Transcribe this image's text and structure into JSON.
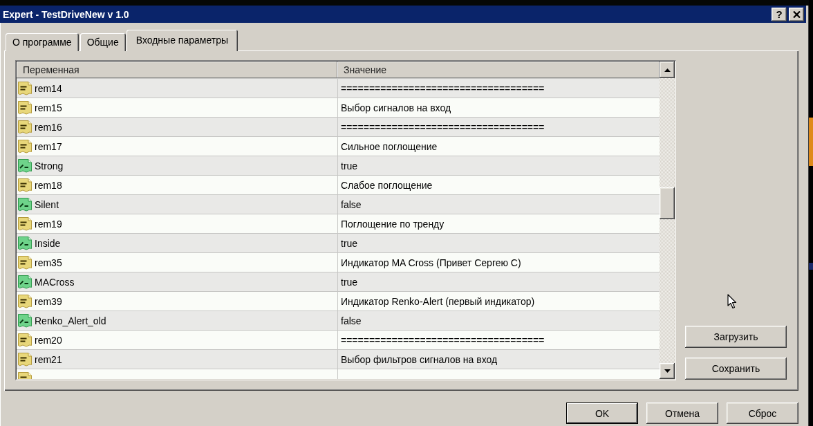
{
  "window": {
    "title": "Expert - TestDriveNew v 1.0",
    "help_button": "?"
  },
  "tabs": [
    {
      "label": "О программе",
      "selected": false
    },
    {
      "label": "Общие",
      "selected": false
    },
    {
      "label": "Входные параметры",
      "selected": true
    }
  ],
  "parameters": {
    "columns": [
      "Переменная",
      "Значение"
    ],
    "rows": [
      {
        "kind": "text",
        "name": "rem14",
        "value": "===================================="
      },
      {
        "kind": "text",
        "name": "rem15",
        "value": "Выбор сигналов на вход"
      },
      {
        "kind": "text",
        "name": "rem16",
        "value": "===================================="
      },
      {
        "kind": "text",
        "name": "rem17",
        "value": "Сильное поглощение"
      },
      {
        "kind": "bool",
        "name": "Strong",
        "value": "true"
      },
      {
        "kind": "text",
        "name": "rem18",
        "value": "Слабое поглощение"
      },
      {
        "kind": "bool",
        "name": "Silent",
        "value": "false"
      },
      {
        "kind": "text",
        "name": "rem19",
        "value": "Поглощение по тренду"
      },
      {
        "kind": "bool",
        "name": "Inside",
        "value": "true"
      },
      {
        "kind": "text",
        "name": "rem35",
        "value": "Индикатор MA Cross (Привет Сергею С)"
      },
      {
        "kind": "bool",
        "name": "MACross",
        "value": "true"
      },
      {
        "kind": "text",
        "name": "rem39",
        "value": "Индикатор Renko-Alert (первый индикатор)"
      },
      {
        "kind": "bool",
        "name": "Renko_Alert_old",
        "value": "false"
      },
      {
        "kind": "text",
        "name": "rem20",
        "value": "===================================="
      },
      {
        "kind": "text",
        "name": "rem21",
        "value": "Выбор фильтров сигналов на вход"
      },
      {
        "kind": "text"
      }
    ]
  },
  "side_buttons": [
    "Загрузить",
    "Сохранить"
  ],
  "dialog_buttons": [
    {
      "label": "OK",
      "default": true
    },
    {
      "label": "Отмена",
      "default": false
    },
    {
      "label": "Сброс",
      "default": false
    }
  ]
}
